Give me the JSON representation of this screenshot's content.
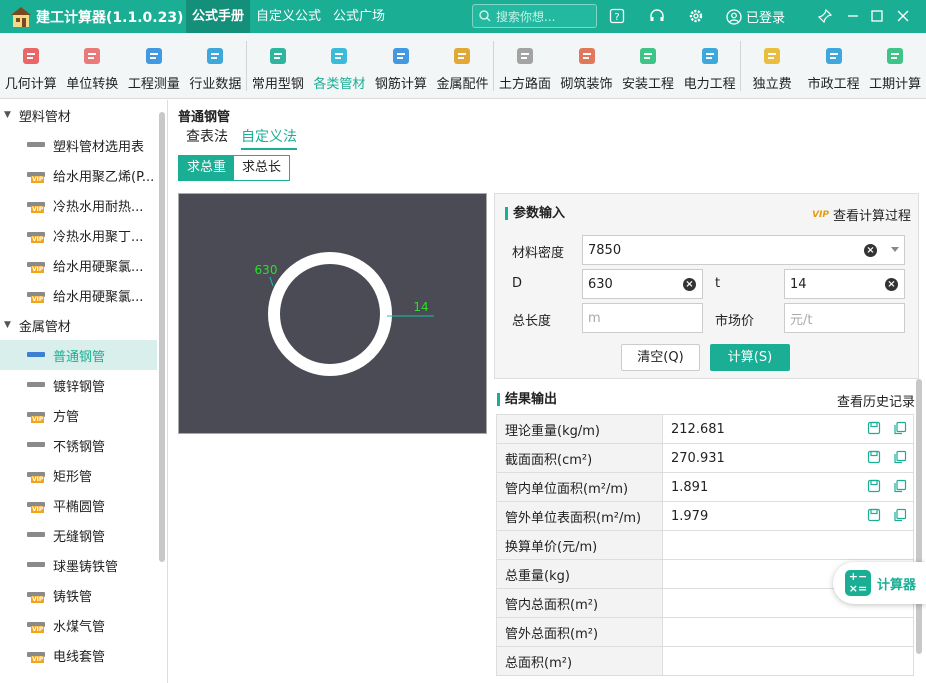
{
  "titlebar": {
    "app_title": "建工计算器(1.1.0.23)",
    "tabs": [
      "公式手册",
      "自定义公式",
      "公式广场"
    ],
    "search_placeholder": "搜索你想...",
    "login_label": "已登录"
  },
  "toolbar": {
    "items": [
      {
        "label": "几何计算",
        "icon": "cube-icon"
      },
      {
        "label": "单位转换",
        "icon": "unit-convert-icon"
      },
      {
        "label": "工程测量",
        "icon": "survey-icon"
      },
      {
        "label": "行业数据",
        "icon": "bar-chart-icon"
      },
      {
        "label": "常用型钢",
        "icon": "wrench-icon"
      },
      {
        "label": "各类管材",
        "icon": "pipe-icon"
      },
      {
        "label": "钢筋计算",
        "icon": "rebar-icon"
      },
      {
        "label": "金属配件",
        "icon": "hardware-icon"
      },
      {
        "label": "土方路面",
        "icon": "road-icon"
      },
      {
        "label": "砌筑装饰",
        "icon": "brick-icon"
      },
      {
        "label": "安装工程",
        "icon": "fan-icon"
      },
      {
        "label": "电力工程",
        "icon": "power-icon"
      },
      {
        "label": "独立费",
        "icon": "fee-icon"
      },
      {
        "label": "市政工程",
        "icon": "municipal-icon"
      },
      {
        "label": "工期计算",
        "icon": "calendar-icon"
      }
    ],
    "active_index": 5
  },
  "sidebar": {
    "categories": [
      {
        "label": "塑料管材",
        "items": [
          {
            "label": "塑料管材选用表",
            "vip": false
          },
          {
            "label": "给水用聚乙烯(P...",
            "vip": true
          },
          {
            "label": "冷热水用耐热...",
            "vip": true
          },
          {
            "label": "冷热水用聚丁...",
            "vip": true
          },
          {
            "label": "给水用硬聚氯...",
            "vip": true
          },
          {
            "label": "给水用硬聚氯...",
            "vip": true
          }
        ]
      },
      {
        "label": "金属管材",
        "items": [
          {
            "label": "普通钢管",
            "vip": false,
            "active": true
          },
          {
            "label": "镀锌钢管",
            "vip": false
          },
          {
            "label": "方管",
            "vip": true
          },
          {
            "label": "不锈钢管",
            "vip": false
          },
          {
            "label": "矩形管",
            "vip": true
          },
          {
            "label": "平椭圆管",
            "vip": true
          },
          {
            "label": "无缝钢管",
            "vip": false
          },
          {
            "label": "球墨铸铁管",
            "vip": false
          },
          {
            "label": "铸铁管",
            "vip": true
          },
          {
            "label": "水煤气管",
            "vip": true
          },
          {
            "label": "电线套管",
            "vip": true
          }
        ]
      }
    ]
  },
  "main": {
    "title": "普通钢管",
    "tabs": [
      "查表法",
      "自定义法"
    ],
    "active_tab": 1,
    "modes": [
      "求总重",
      "求总长"
    ],
    "active_mode": 0,
    "diagram": {
      "d_label": "630",
      "t_label": "14"
    }
  },
  "params": {
    "title": "参数输入",
    "view_process": "查看计算过程",
    "vip_badge": "VIP",
    "density_label": "材料密度",
    "density_value": "7850",
    "d_label": "D",
    "d_value": "630",
    "t_label": "t",
    "t_value": "14",
    "length_label": "总长度",
    "length_placeholder": "m",
    "price_label": "市场价",
    "price_placeholder": "元/t",
    "clear_button": "清空(Q)",
    "calc_button": "计算(S)"
  },
  "results": {
    "title": "结果输出",
    "history": "查看历史记录",
    "rows": [
      {
        "label": "理论重量(kg/m)",
        "value": "212.681"
      },
      {
        "label": "截面面积(cm²)",
        "value": "270.931"
      },
      {
        "label": "管内单位面积(m²/m)",
        "value": "1.891"
      },
      {
        "label": "管外单位表面积(m²/m)",
        "value": "1.979"
      },
      {
        "label": "换算单价(元/m)",
        "value": ""
      },
      {
        "label": "总重量(kg)",
        "value": ""
      },
      {
        "label": "管内总面积(m²)",
        "value": ""
      },
      {
        "label": "管外总面积(m²)",
        "value": ""
      },
      {
        "label": "总面积(m²)",
        "value": ""
      }
    ]
  },
  "floating": {
    "label": "计算器"
  },
  "colors": {
    "accent": "#1aae95",
    "diagram_bg": "#4a4b55"
  }
}
